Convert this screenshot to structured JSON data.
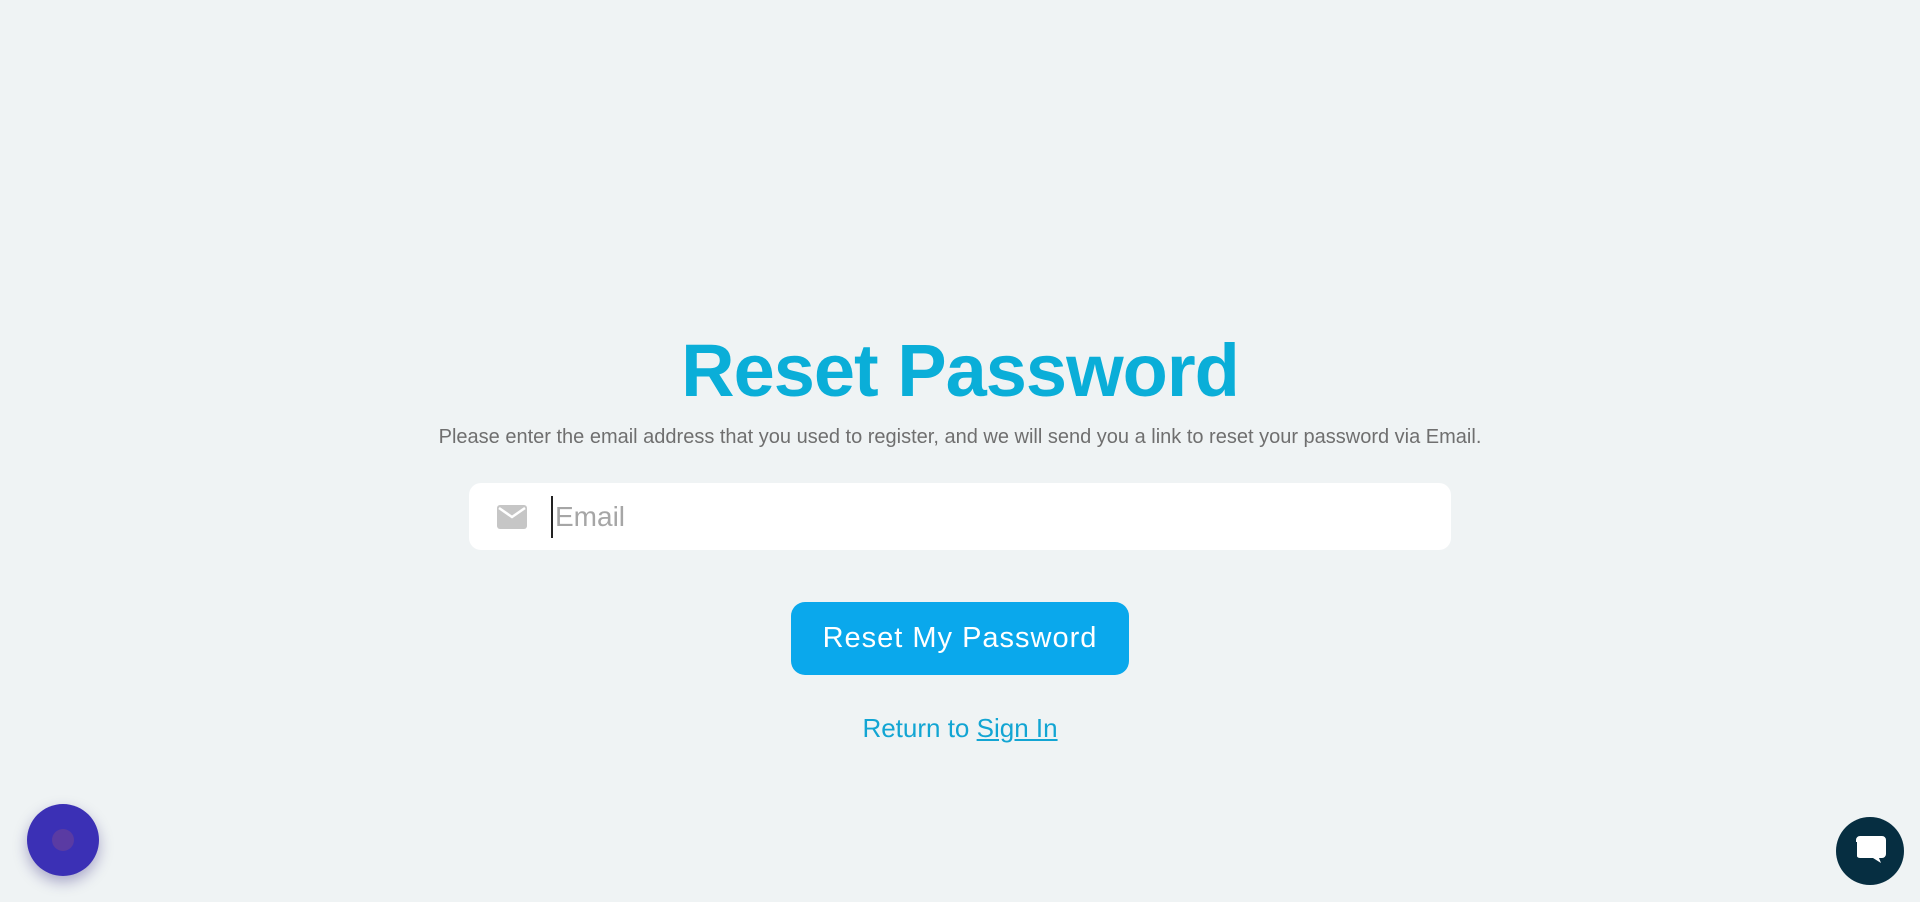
{
  "page": {
    "title": "Reset Password",
    "subtitle": "Please enter the email address that you used to register, and we will send you a link to reset your password via Email."
  },
  "form": {
    "email": {
      "icon": "mail-icon",
      "placeholder": "Email",
      "value": ""
    },
    "submit_label": "Reset My Password"
  },
  "footer": {
    "return_prefix": "Return to ",
    "signin_label": "Sign In"
  },
  "widgets": {
    "left_icon": "assistant-launcher-icon",
    "right_icon": "chat-bubble-icon"
  },
  "colors": {
    "background": "#eff3f4",
    "title": "#0aaed8",
    "button": "#0aa8ec",
    "link": "#12a5d3",
    "left_widget": "#3b30b5",
    "right_widget": "#062e41"
  }
}
